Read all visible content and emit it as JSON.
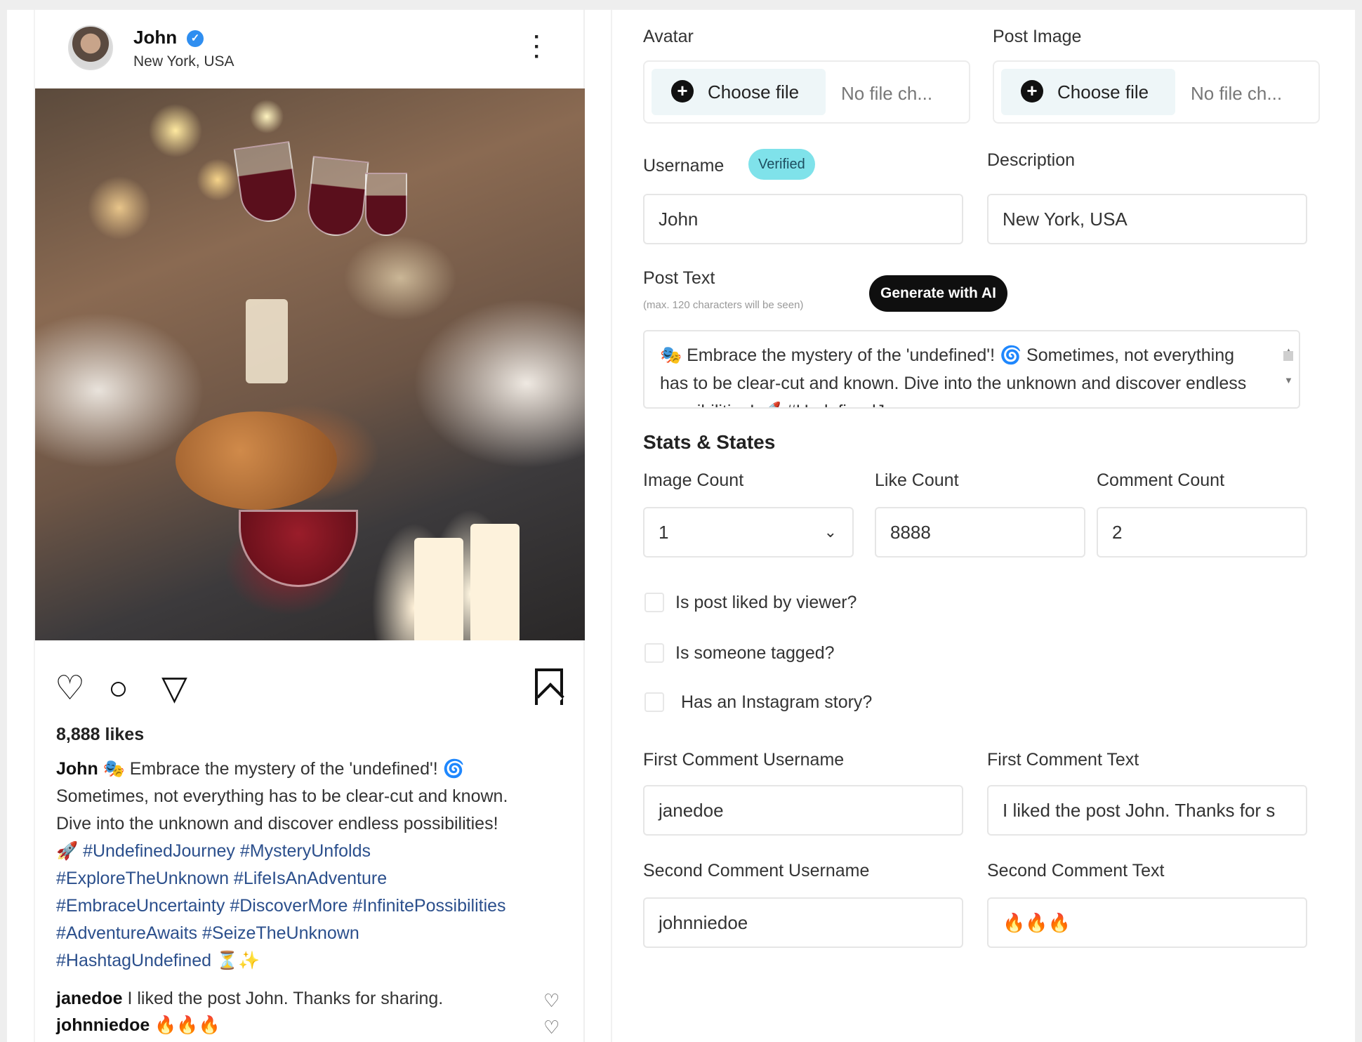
{
  "post": {
    "username": "John",
    "location": "New York, USA",
    "likes_text": "8,888 likes",
    "caption_user": "John",
    "caption_lines": [
      "🎭 Embrace the mystery of the 'undefined'! 🌀",
      "Sometimes, not everything has to be clear-cut and known.",
      "Dive into the unknown and discover endless possibilities!"
    ],
    "hashtag_lines": [
      "🚀 #UndefinedJourney #MysteryUnfolds",
      "#ExploreTheUnknown #LifeIsAnAdventure",
      "#EmbraceUncertainty #DiscoverMore #InfinitePossibilities",
      "#AdventureAwaits #SeizeTheUnknown",
      "#HashtagUndefined ⏳✨"
    ],
    "comments": [
      {
        "user": "janedoe",
        "text": "I liked the post John. Thanks for sharing."
      },
      {
        "user": "johnniedoe",
        "text": "🔥🔥🔥"
      }
    ]
  },
  "form": {
    "avatar_label": "Avatar",
    "post_image_label": "Post Image",
    "choose_file": "Choose file",
    "no_file": "No file ch...",
    "username_label": "Username",
    "verified_badge": "Verified",
    "username_value": "John",
    "description_label": "Description",
    "description_value": "New York, USA",
    "post_text_label": "Post Text",
    "post_text_hint": "(max. 120 characters will be seen)",
    "generate_ai": "Generate with AI",
    "post_text_value": "🎭 Embrace the mystery of the 'undefined'! 🌀 Sometimes, not everything has to be clear-cut and known. Dive into the unknown and discover endless possibilities! 🚀 #UndefinedJourney",
    "stats_heading": "Stats & States",
    "image_count_label": "Image Count",
    "image_count_value": "1",
    "like_count_label": "Like Count",
    "like_count_value": "8888",
    "comment_count_label": "Comment Count",
    "comment_count_value": "2",
    "check_liked": "Is post liked by viewer?",
    "check_tagged": "Is someone tagged?",
    "check_story": "Has an Instagram story?",
    "first_comment_user_label": "First Comment Username",
    "first_comment_user_value": "janedoe",
    "first_comment_text_label": "First Comment Text",
    "first_comment_text_value": "I liked the post John. Thanks for s",
    "second_comment_user_label": "Second Comment Username",
    "second_comment_user_value": "johnniedoe",
    "second_comment_text_label": "Second Comment Text",
    "second_comment_text_value": "🔥🔥🔥"
  },
  "icons": {
    "heart": "heart-icon",
    "comment": "comment-icon",
    "share": "share-icon",
    "bookmark": "bookmark-icon",
    "more": "more-icon",
    "plus": "plus-circle-icon",
    "verified": "verified-icon"
  },
  "colors": {
    "verified_badge": "#7fe2ea",
    "hashtag": "#2b4f8c",
    "ai_button": "#0f0f0f"
  }
}
